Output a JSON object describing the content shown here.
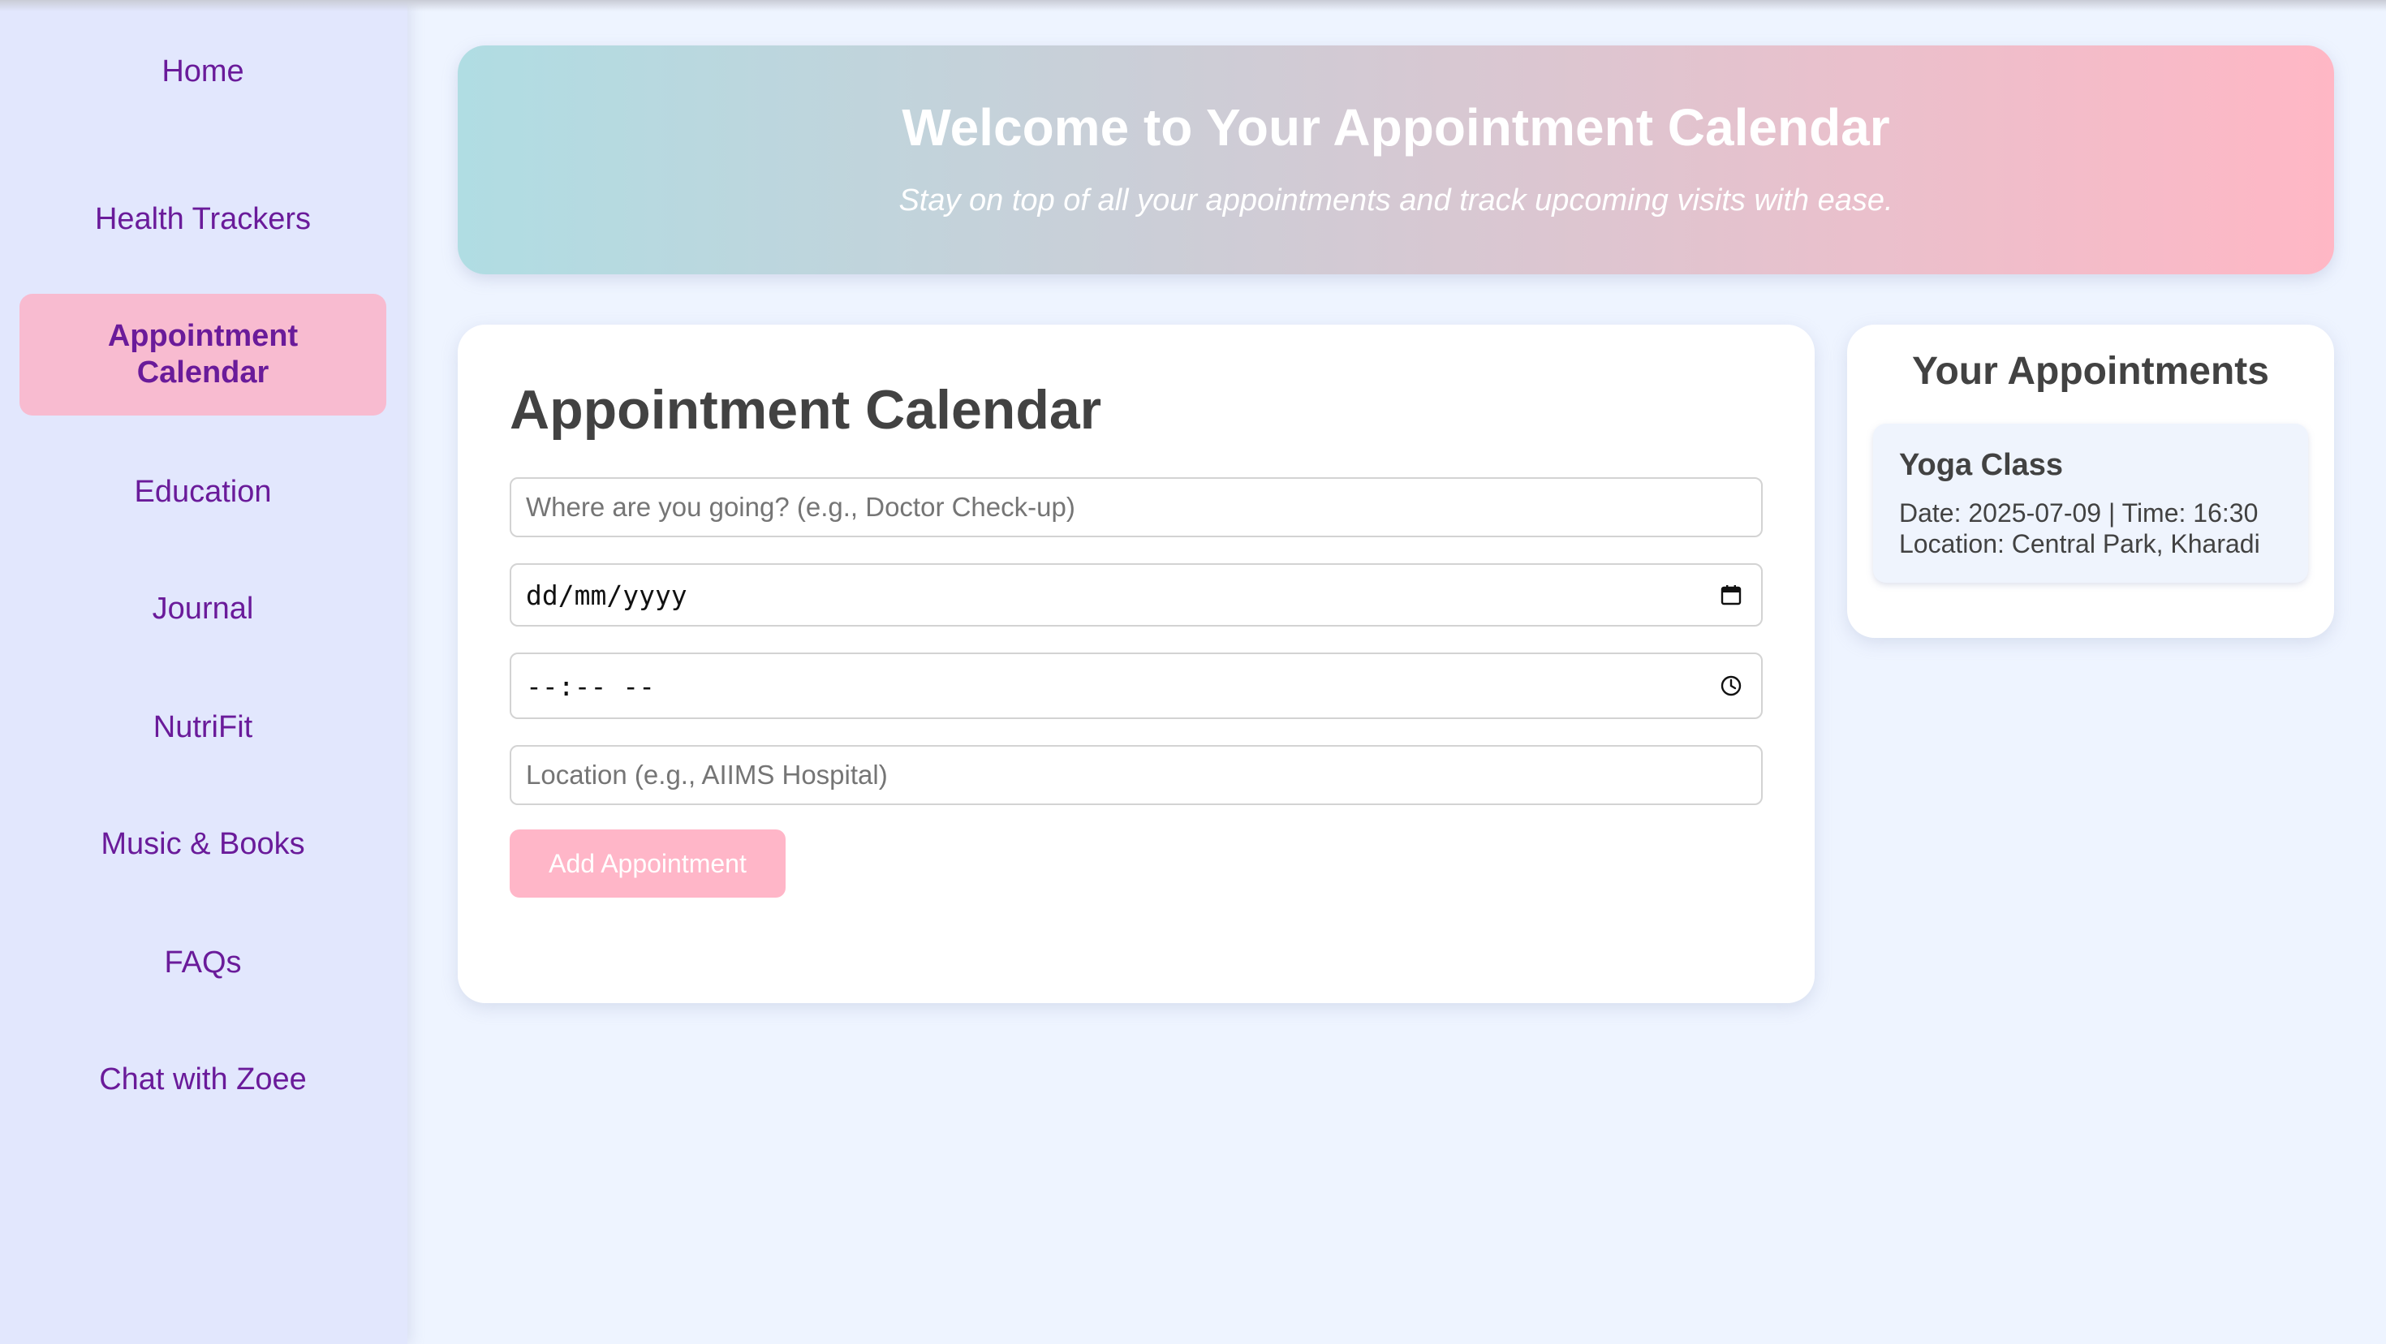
{
  "sidebar": {
    "items": [
      {
        "label": "Home"
      },
      {
        "label": "Health Trackers"
      },
      {
        "label": "Appointment Calendar",
        "active": true
      },
      {
        "label": "Education"
      },
      {
        "label": "Journal"
      },
      {
        "label": "NutriFit"
      },
      {
        "label": "Music & Books"
      },
      {
        "label": "FAQs"
      },
      {
        "label": "Chat with Zoee"
      }
    ]
  },
  "hero": {
    "title": "Welcome to Your Appointment Calendar",
    "subtitle": "Stay on top of all your appointments and track upcoming visits with ease."
  },
  "form": {
    "title": "Appointment Calendar",
    "purpose_placeholder": "Where are you going? (e.g., Doctor Check-up)",
    "date_display": "dd/mm/yyyy",
    "time_display": "--:-- --",
    "location_placeholder": "Location (e.g., AIIMS Hospital)",
    "add_label": "Add Appointment"
  },
  "appointments": {
    "title": "Your Appointments",
    "items": [
      {
        "name": "Yoga Class",
        "date_time": "Date: 2025-07-09 | Time: 16:30",
        "location": "Location: Central Park, Kharadi"
      }
    ]
  },
  "colors": {
    "nav_text": "#6a1b9a",
    "active_bg": "#f8bbd0",
    "button_bg": "#ffb6c8",
    "page_bg": "#eef4ff"
  },
  "icons": {
    "date_field": "calendar-icon",
    "time_field": "clock-icon"
  }
}
